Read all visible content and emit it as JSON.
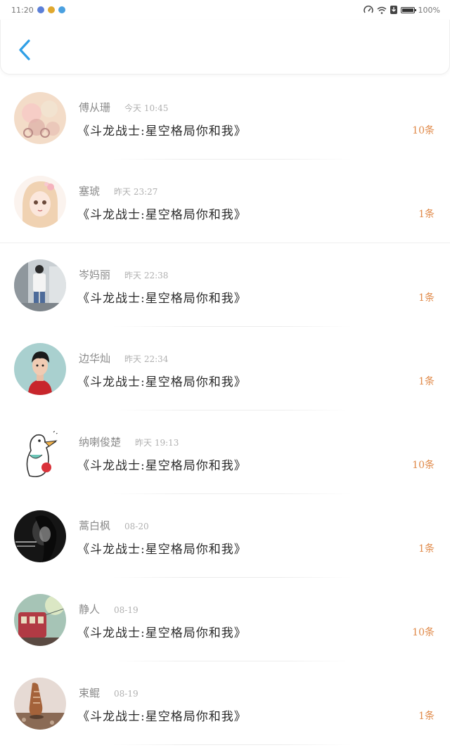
{
  "status_bar": {
    "time": "11:20",
    "battery": "100%"
  },
  "header": {
    "back_icon": "chevron-left-icon",
    "accent": "#2f9fe6"
  },
  "colors": {
    "count": "#e08a4a",
    "name": "#8a8a8a",
    "time": "#b0b0b0"
  },
  "messages": [
    {
      "name": "傅从珊",
      "time": "今天 10:45",
      "title": "《斗龙战士:星空格局你和我》",
      "count": "10条"
    },
    {
      "name": "塞琥",
      "time": "昨天 23:27",
      "title": "《斗龙战士:星空格局你和我》",
      "count": "1条"
    },
    {
      "name": "岑妈丽",
      "time": "昨天 22:38",
      "title": "《斗龙战士:星空格局你和我》",
      "count": "1条"
    },
    {
      "name": "边华灿",
      "time": "昨天 22:34",
      "title": "《斗龙战士:星空格局你和我》",
      "count": "1条"
    },
    {
      "name": "纳喇俊楚",
      "time": "昨天 19:13",
      "title": "《斗龙战士:星空格局你和我》",
      "count": "10条"
    },
    {
      "name": "蒿白枫",
      "time": "08-20",
      "title": "《斗龙战士:星空格局你和我》",
      "count": "1条"
    },
    {
      "name": "静人",
      "time": "08-19",
      "title": "《斗龙战士:星空格局你和我》",
      "count": "10条"
    },
    {
      "name": "束鲲",
      "time": "08-19",
      "title": "《斗龙战士:星空格局你和我》",
      "count": "1条"
    }
  ]
}
